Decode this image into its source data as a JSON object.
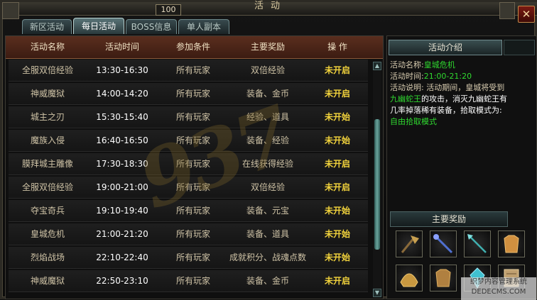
{
  "window": {
    "title": "活动",
    "badge": "100",
    "close_glyph": "✕"
  },
  "tabs": [
    {
      "label": "新区活动",
      "active": false
    },
    {
      "label": "每日活动",
      "active": true
    },
    {
      "label": "BOSS信息",
      "active": false
    },
    {
      "label": "单人副本",
      "active": false
    }
  ],
  "table": {
    "headers": [
      "活动名称",
      "活动时间",
      "参加条件",
      "主要奖励",
      "操 作"
    ],
    "rows": [
      {
        "name": "全服双倍经验",
        "time": "13:30-16:30",
        "condition": "所有玩家",
        "reward": "双倍经验",
        "action": "未开启"
      },
      {
        "name": "神威魔狱",
        "time": "14:00-14:20",
        "condition": "所有玩家",
        "reward": "装备、金币",
        "action": "未开启"
      },
      {
        "name": "城主之刃",
        "time": "15:30-15:40",
        "condition": "所有玩家",
        "reward": "经验、道具",
        "action": "未开始"
      },
      {
        "name": "魔族入侵",
        "time": "16:40-16:50",
        "condition": "所有玩家",
        "reward": "装备、经验",
        "action": "未开始"
      },
      {
        "name": "膜拜城主雕像",
        "time": "17:30-18:30",
        "condition": "所有玩家",
        "reward": "在线获得经验",
        "action": "未开启"
      },
      {
        "name": "全服双倍经验",
        "time": "19:00-21:00",
        "condition": "所有玩家",
        "reward": "双倍经验",
        "action": "未开启"
      },
      {
        "name": "夺宝奇兵",
        "time": "19:10-19:40",
        "condition": "所有玩家",
        "reward": "装备、元宝",
        "action": "未开始"
      },
      {
        "name": "皇城危机",
        "time": "21:00-21:20",
        "condition": "所有玩家",
        "reward": "装备、道具",
        "action": "未开始"
      },
      {
        "name": "烈焰战场",
        "time": "22:10-22:40",
        "condition": "所有玩家",
        "reward": "成就积分、战魂点数",
        "action": "未开始"
      },
      {
        "name": "神威魔狱",
        "time": "22:50-23:10",
        "condition": "所有玩家",
        "reward": "装备、金币",
        "action": "未开启"
      }
    ]
  },
  "watermark": "937",
  "info": {
    "header": "活动介绍",
    "name_label": "活动名称:",
    "name_value": "皇城危机",
    "time_label": "活动时间:",
    "time_value": "21:00-21:20",
    "desc_1": "活动说明: 活动期间，皇城将受到",
    "desc_boss": "九幽蛇王",
    "desc_2": "的攻击，消灭九幽蛇王有",
    "desc_3": "几率掉落稀有装备，拾取模式为:",
    "desc_mode": "自由拾取模式"
  },
  "rewards": {
    "header": "主要奖励",
    "items": [
      {
        "icon": "axe-weapon-icon",
        "color": "#c8a050"
      },
      {
        "icon": "blue-staff-icon",
        "color": "#5070d0"
      },
      {
        "icon": "cyan-spear-icon",
        "color": "#40b0b0"
      },
      {
        "icon": "gold-armor-icon",
        "color": "#d09040"
      },
      {
        "icon": "gold-helmet-icon",
        "color": "#c89840"
      },
      {
        "icon": "bronze-armor-icon",
        "color": "#b08040"
      },
      {
        "icon": "cyan-gem-icon",
        "color": "#40c0d0"
      },
      {
        "icon": "scroll-icon",
        "color": "#c0a070"
      }
    ]
  },
  "site_mark": {
    "line1": "织梦内容管理系统",
    "line2": "DEDECMS.COM"
  }
}
